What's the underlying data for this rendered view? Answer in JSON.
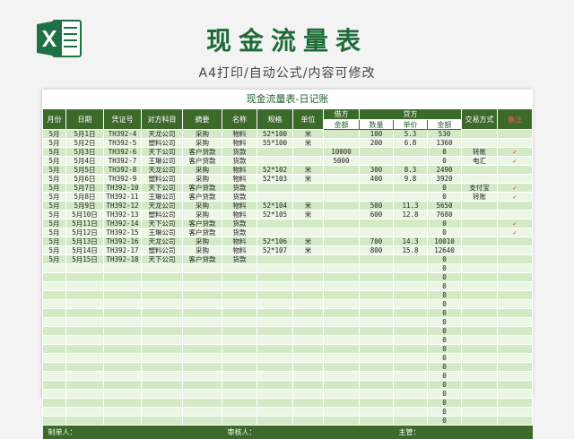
{
  "header": {
    "title": "现金流量表",
    "subtitle": "A4打印/自动公式/内容可修改"
  },
  "sheet": {
    "caption": "现金流量表-日记账",
    "columns": [
      "月份",
      "日期",
      "凭证号",
      "对方科目",
      "摘要",
      "名称",
      "规格",
      "单位",
      "借方",
      "贷方",
      "交易方式",
      "备注"
    ],
    "subcolumns": {
      "debit_amount": "金额",
      "qty": "数量",
      "unit_price": "单价",
      "credit_amount": "金额"
    },
    "rows": [
      [
        "5月",
        "5月1日",
        "TH392-4",
        "天龙公司",
        "采购",
        "物料",
        "52*100",
        "米",
        "",
        "100",
        "5.3",
        "530",
        "",
        ""
      ],
      [
        "5月",
        "5月2日",
        "TH392-5",
        "塑料公司",
        "采购",
        "物料",
        "55*100",
        "米",
        "",
        "200",
        "6.8",
        "1360",
        "",
        ""
      ],
      [
        "5月",
        "5月3日",
        "TH392-6",
        "天下公司",
        "客户贷款",
        "货款",
        "",
        "",
        "10000",
        "",
        "",
        "0",
        "转账",
        "✓"
      ],
      [
        "5月",
        "5月4日",
        "TH392-7",
        "王琳公司",
        "客户贷款",
        "货款",
        "",
        "",
        "5000",
        "",
        "",
        "0",
        "电汇",
        "✓"
      ],
      [
        "5月",
        "5月5日",
        "TH392-8",
        "天龙公司",
        "采购",
        "物料",
        "52*102",
        "米",
        "",
        "300",
        "8.3",
        "2490",
        "",
        ""
      ],
      [
        "5月",
        "5月6日",
        "TH392-9",
        "塑料公司",
        "采购",
        "物料",
        "52*103",
        "米",
        "",
        "400",
        "9.8",
        "3920",
        "",
        ""
      ],
      [
        "5月",
        "5月7日",
        "TH392-10",
        "天下公司",
        "客户贷款",
        "货款",
        "",
        "",
        "",
        "",
        "",
        "0",
        "支付宝",
        "✓"
      ],
      [
        "5月",
        "5月8日",
        "TH392-11",
        "王琳公司",
        "客户贷款",
        "货款",
        "",
        "",
        "",
        "",
        "",
        "0",
        "转账",
        "✓"
      ],
      [
        "5月",
        "5月9日",
        "TH392-12",
        "天龙公司",
        "采购",
        "物料",
        "52*104",
        "米",
        "",
        "500",
        "11.3",
        "5650",
        "",
        ""
      ],
      [
        "5月",
        "5月10日",
        "TH392-13",
        "塑料公司",
        "采购",
        "物料",
        "52*105",
        "米",
        "",
        "600",
        "12.8",
        "7680",
        "",
        ""
      ],
      [
        "5月",
        "5月11日",
        "TH392-14",
        "天下公司",
        "客户贷款",
        "货款",
        "",
        "",
        "",
        "",
        "",
        "0",
        "",
        "✓"
      ],
      [
        "5月",
        "5月12日",
        "TH392-15",
        "王琳公司",
        "客户贷款",
        "货款",
        "",
        "",
        "",
        "",
        "",
        "0",
        "",
        "✓"
      ],
      [
        "5月",
        "5月13日",
        "TH392-16",
        "天龙公司",
        "采购",
        "物料",
        "52*106",
        "米",
        "",
        "700",
        "14.3",
        "10010",
        "",
        ""
      ],
      [
        "5月",
        "5月14日",
        "TH392-17",
        "塑料公司",
        "采购",
        "物料",
        "52*107",
        "米",
        "",
        "800",
        "15.8",
        "12640",
        "",
        ""
      ],
      [
        "5月",
        "5月15日",
        "TH392-18",
        "天下公司",
        "客户贷款",
        "货款",
        "",
        "",
        "",
        "",
        "",
        "0",
        "",
        ""
      ]
    ],
    "empty_rows": 18,
    "empty_balance": "0",
    "footer": {
      "preparer": "制单人：",
      "reviewer": "审核人：",
      "supervisor": "主管："
    }
  },
  "colors": {
    "brand": "#1f6b38",
    "header_bg": "#3b6a2b",
    "row_odd": "#d4e9c6",
    "row_even": "#ecf6e4",
    "check": "#e03030"
  },
  "icons": {
    "logo": "excel-logo-icon",
    "check": "check-mark-icon"
  }
}
